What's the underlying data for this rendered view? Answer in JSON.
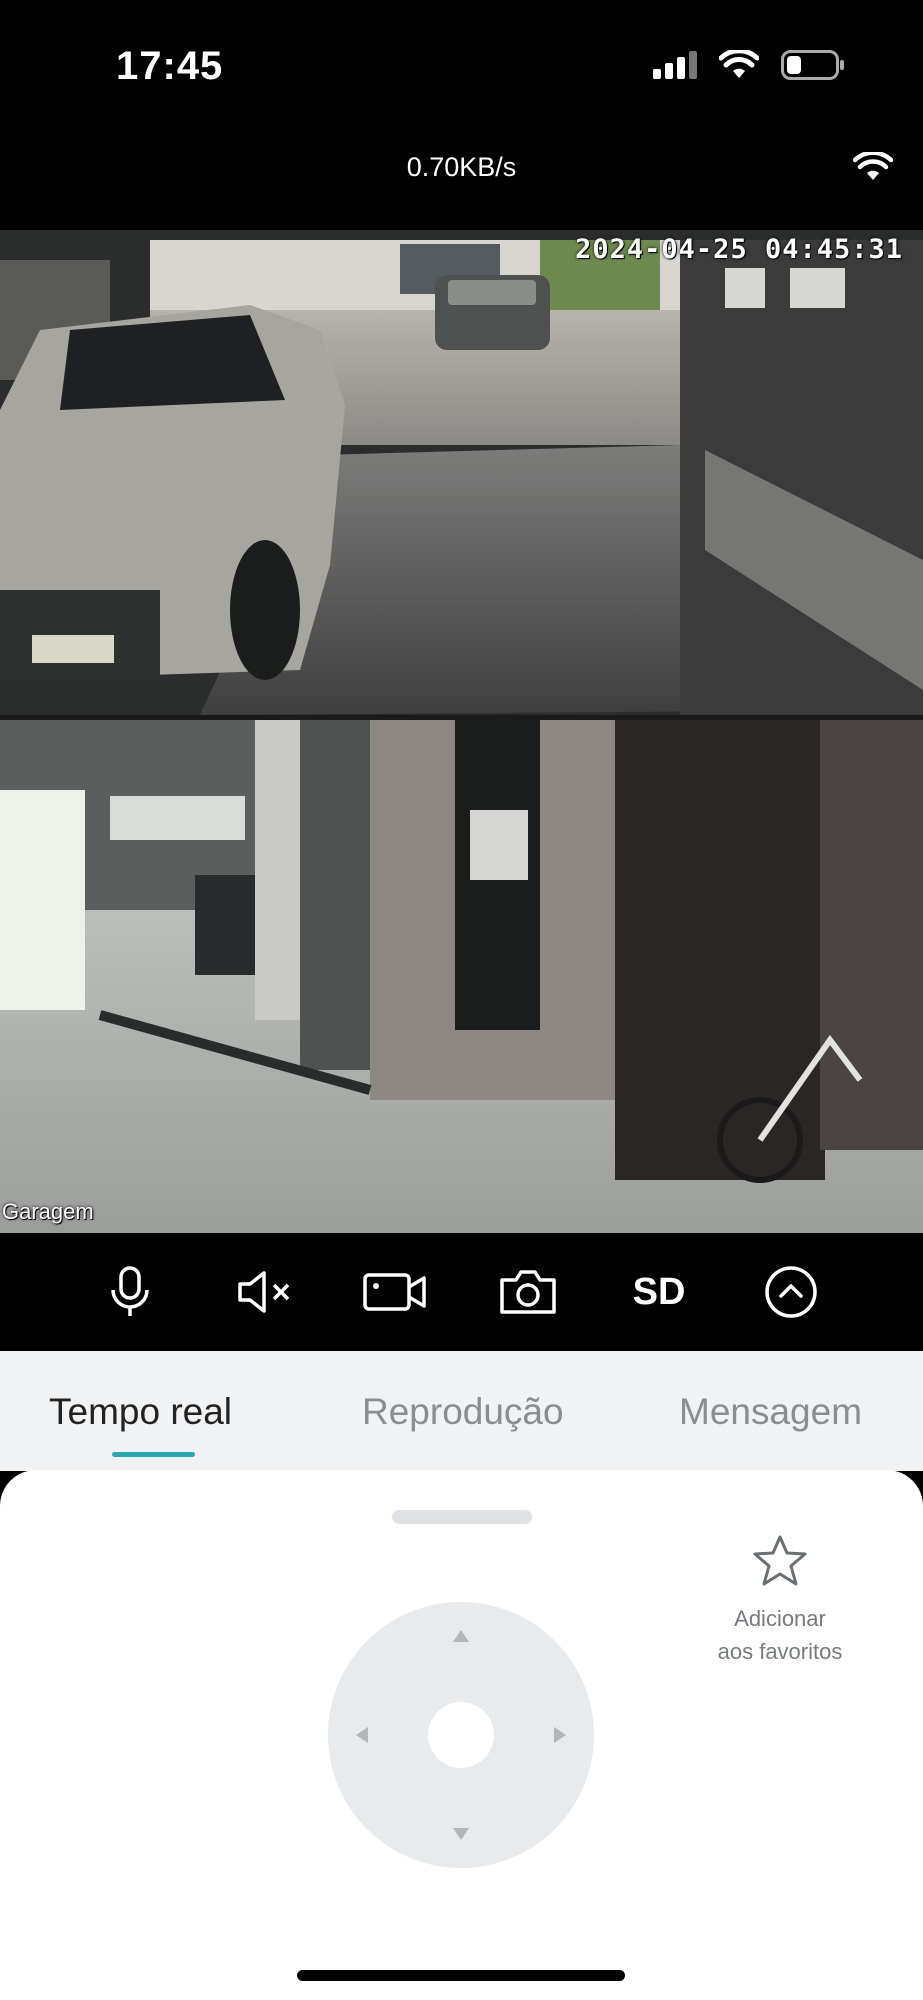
{
  "status_bar": {
    "time": "17:45"
  },
  "stream": {
    "speed": "0.70KB/s"
  },
  "video": {
    "timestamp": "2024-04-25 04:45:31",
    "camera_label": "Garagem"
  },
  "controls": {
    "sd_label": "SD"
  },
  "tabs": [
    {
      "label": "Tempo real",
      "active": true
    },
    {
      "label": "Reprodução",
      "active": false
    },
    {
      "label": "Mensagem",
      "active": false
    }
  ],
  "favorites": {
    "line1": "Adicionar",
    "line2": "aos favoritos"
  },
  "colors": {
    "accent": "#2ea6b0",
    "background": "#f1f2f3",
    "panel": "#ffffff",
    "joystick": "#e9eaeb"
  },
  "icons": [
    "cellular-signal-icon",
    "wifi-icon",
    "battery-icon",
    "microphone-icon",
    "speaker-mute-icon",
    "video-record-icon",
    "camera-icon",
    "chevron-up-icon",
    "star-icon",
    "arrow-up-icon",
    "arrow-down-icon",
    "arrow-left-icon",
    "arrow-right-icon"
  ]
}
